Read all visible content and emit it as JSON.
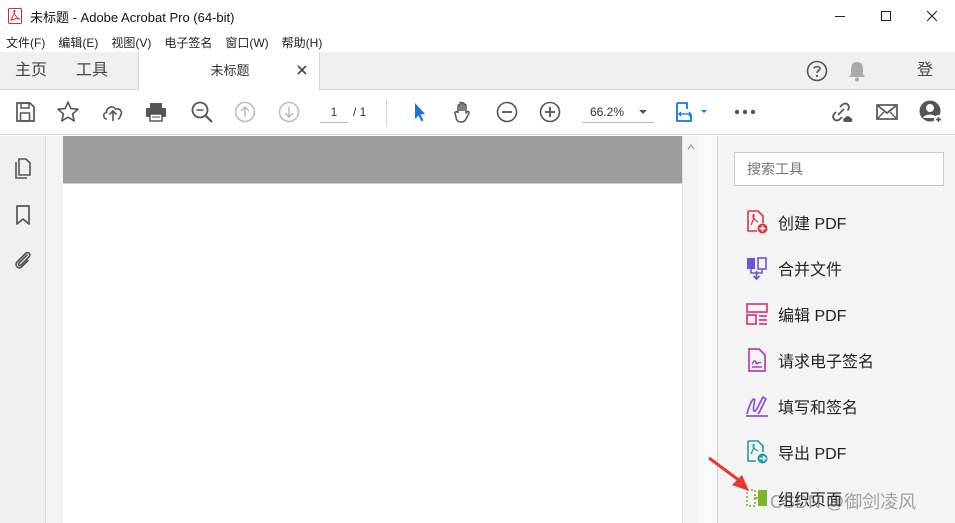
{
  "window": {
    "title": "未标题 - Adobe Acrobat Pro (64-bit)"
  },
  "menu": [
    "文件(F)",
    "编辑(E)",
    "视图(V)",
    "电子签名",
    "窗口(W)",
    "帮助(H)"
  ],
  "tabs": {
    "home": "主页",
    "tools": "工具",
    "document": "未标题"
  },
  "header_right": {
    "login": "登录"
  },
  "toolbar": {
    "page_current": "1",
    "page_total": "/ 1",
    "zoom": "66.2%"
  },
  "search": {
    "placeholder": "搜索工具"
  },
  "tools": [
    {
      "label": "创建 PDF",
      "icon": "create-pdf-icon",
      "color": "#e0323c"
    },
    {
      "label": "合并文件",
      "icon": "combine-files-icon",
      "color": "#6a57d8"
    },
    {
      "label": "编辑 PDF",
      "icon": "edit-pdf-icon",
      "color": "#d83b7c"
    },
    {
      "label": "请求电子签名",
      "icon": "request-esign-icon",
      "color": "#b43fae"
    },
    {
      "label": "填写和签名",
      "icon": "fill-sign-icon",
      "color": "#8a4fd6"
    },
    {
      "label": "导出 PDF",
      "icon": "export-pdf-icon",
      "color": "#1f9aa5"
    },
    {
      "label": "组织页面",
      "icon": "organize-pages-icon",
      "color": "#76b82a"
    }
  ],
  "watermark": "CSDN @御剑凌风",
  "colors": {
    "accent_blue": "#1473e6",
    "tab_bg": "#f0f0f0",
    "page_gray": "#9c9c9c",
    "arrow_red": "#e53935"
  }
}
